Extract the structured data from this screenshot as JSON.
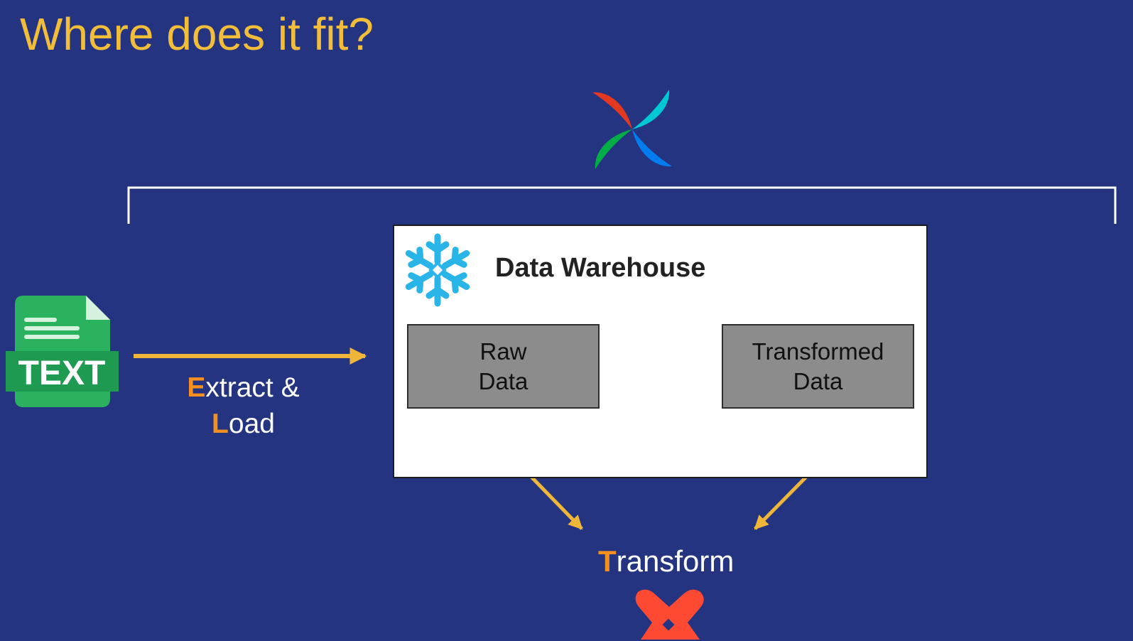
{
  "slide": {
    "title": "Where does it fit?"
  },
  "warehouse": {
    "title": "Data Warehouse",
    "raw": {
      "line1": "Raw",
      "line2": "Data"
    },
    "transformed": {
      "line1": "Transformed",
      "line2": "Data"
    }
  },
  "extract_load": {
    "e_initial": "E",
    "line1_rest": "xtract &",
    "l_initial": "L",
    "line2_rest": "oad"
  },
  "transform": {
    "t_initial": "T",
    "rest": "ransform"
  },
  "text_file_icon": {
    "label": "TEXT"
  },
  "colors": {
    "background": "#253480",
    "title": "#f2bd39",
    "arrow": "#f0b63a",
    "accent_letter": "#f5901e",
    "bracket": "#ffffff",
    "warehouse_box": "#ffffff",
    "stage_box": "#8c8c8c",
    "snowflake": "#29b5e8",
    "text_file": "#2bb25f",
    "dbt": "#fe4a33"
  },
  "icons": {
    "orchestrator": "pinwheel-icon",
    "warehouse": "snowflake-icon",
    "source": "text-file-icon",
    "transformer": "dbt-icon"
  }
}
